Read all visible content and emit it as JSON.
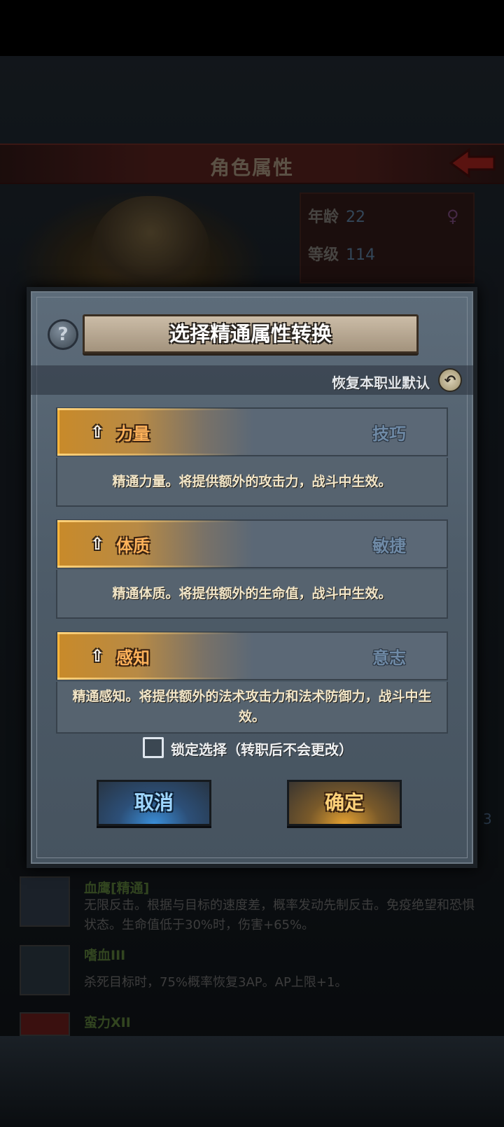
{
  "background": {
    "title": "角色属性",
    "stats": [
      {
        "label": "年龄",
        "value": "22"
      },
      {
        "label": "等级",
        "value": "114"
      }
    ],
    "skills": [
      {
        "name": "血鹰[精通]",
        "desc": "无限反击。根据与目标的速度差，概率发动先制反击。免疫绝望和恐惧状态。生命值低于30%时，伤害+65%。"
      },
      {
        "name": "嗜血III",
        "desc": "杀死目标时，75%概率恢复3AP。AP上限+1。"
      },
      {
        "name": "蛮力XII",
        "desc": ""
      }
    ],
    "side_number": "3"
  },
  "dialog": {
    "title": "选择精通属性转换",
    "help_icon": "question-icon",
    "reset_label": "恢复本职业默认",
    "options": [
      {
        "main": "力量",
        "alt": "技巧",
        "desc": "精通力量。将提供额外的攻击力，战斗中生效。"
      },
      {
        "main": "体质",
        "alt": "敏捷",
        "desc": "精通体质。将提供额外的生命值，战斗中生效。"
      },
      {
        "main": "感知",
        "alt": "意志",
        "desc": "精通感知。将提供额外的法术攻击力和法术防御力，战斗中生效。"
      }
    ],
    "lock_label": "锁定选择（转职后不会更改）",
    "lock_checked": false,
    "cancel_label": "取消",
    "confirm_label": "确定"
  },
  "colors": {
    "accent_orange": "#ffb25a",
    "cancel_blue": "#9fd6ff",
    "confirm_gold": "#ffd27a"
  }
}
